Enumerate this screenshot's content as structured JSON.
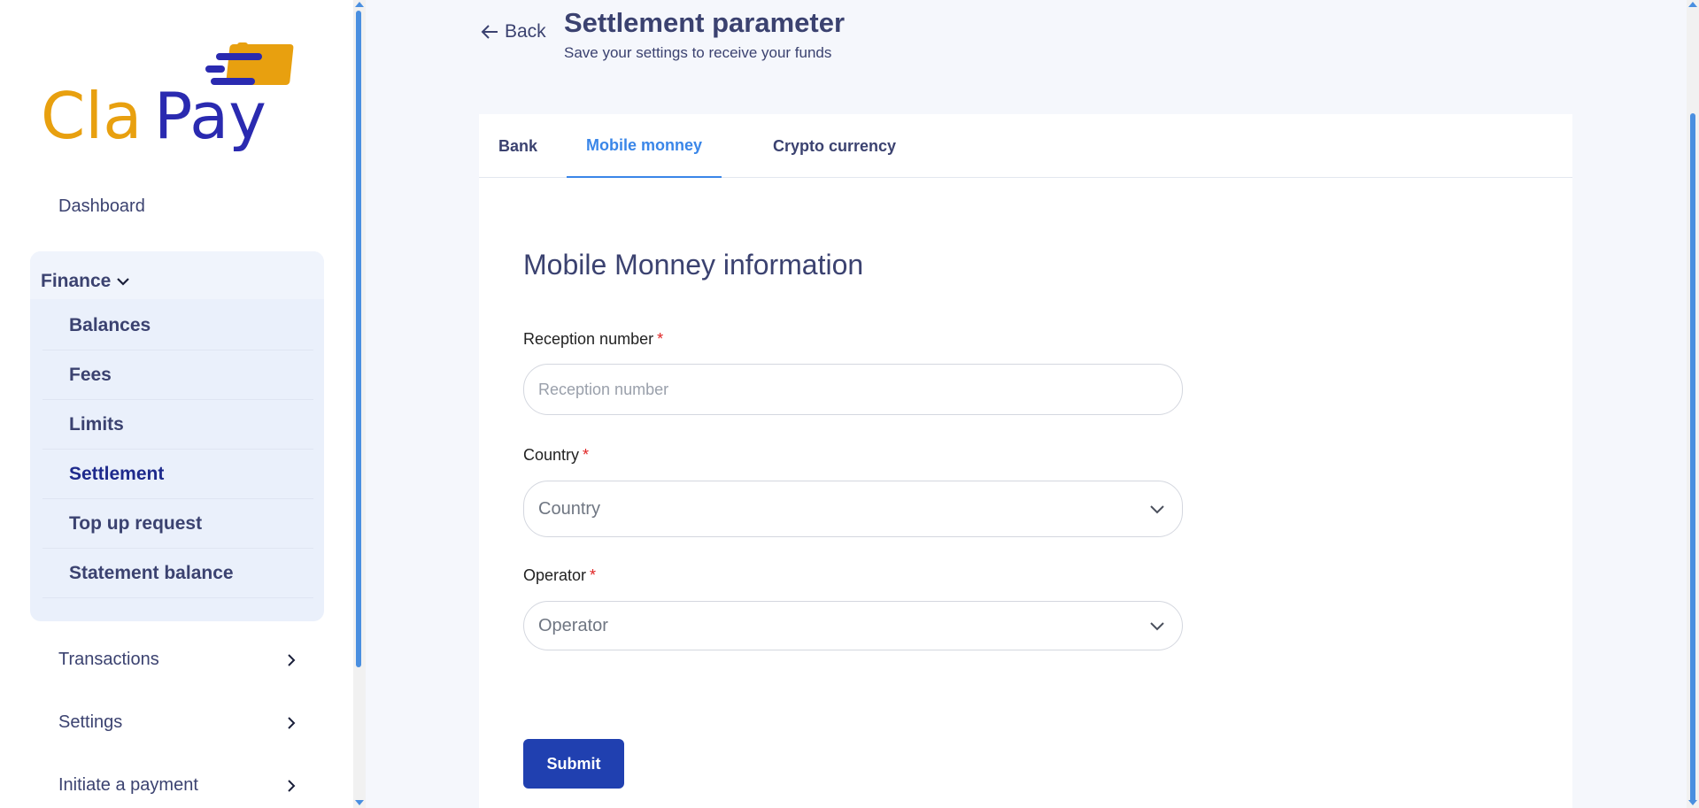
{
  "brand": {
    "logo_text_cla": "Cla",
    "logo_text_pay": "Pay",
    "primary": "#1e2a8c",
    "accent": "#e8a00f"
  },
  "sidebar": {
    "dashboard": "Dashboard",
    "finance": {
      "label": "Finance",
      "expanded": true,
      "items": [
        {
          "label": "Balances"
        },
        {
          "label": "Fees"
        },
        {
          "label": "Limits"
        },
        {
          "label": "Settlement",
          "active": true
        },
        {
          "label": "Top up request"
        },
        {
          "label": "Statement balance"
        }
      ]
    },
    "transactions": "Transactions",
    "settings": "Settings",
    "initiate_payment": "Initiate a payment"
  },
  "header": {
    "back": "Back",
    "title": "Settlement parameter",
    "subtitle": "Save your settings to receive your funds"
  },
  "tabs": [
    {
      "label": "Bank"
    },
    {
      "label": "Mobile monney",
      "active": true
    },
    {
      "label": "Crypto currency"
    }
  ],
  "form": {
    "section_title": "Mobile Monney information",
    "reception_number": {
      "label": "Reception number",
      "required": "*",
      "placeholder": "Reception number"
    },
    "country": {
      "label": "Country",
      "required": "*",
      "value": "Country"
    },
    "operator": {
      "label": "Operator",
      "required": "*",
      "value": "Operator"
    },
    "submit": "Submit"
  },
  "icons": {
    "back": "arrow-left-icon",
    "dropdown": "chevron-down-icon",
    "nav": "chevron-right-icon"
  }
}
